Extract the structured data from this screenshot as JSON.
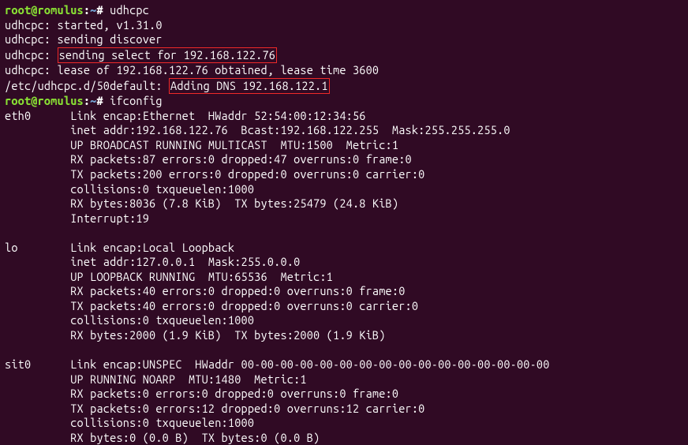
{
  "prompt": {
    "user_host": "root@romulus",
    "sep1": ":",
    "path": "~",
    "sep2": "# "
  },
  "cmd1": "udhcpc",
  "udhcpc": {
    "l1": "udhcpc: started, v1.31.0",
    "l2": "udhcpc: sending discover",
    "l3a": "udhcpc: ",
    "l3b": "sending select for 192.168.122.76",
    "l4": "udhcpc: lease of 192.168.122.76 obtained, lease time 3600",
    "l5a": "/etc/udhcpc.d/50default: ",
    "l5b": "Adding DNS 192.168.122.1"
  },
  "cmd2": "ifconfig",
  "eth0": {
    "l1": "eth0      Link encap:Ethernet  HWaddr 52:54:00:12:34:56  ",
    "l2": "          inet addr:192.168.122.76  Bcast:192.168.122.255  Mask:255.255.255.0",
    "l3": "          UP BROADCAST RUNNING MULTICAST  MTU:1500  Metric:1",
    "l4": "          RX packets:87 errors:0 dropped:47 overruns:0 frame:0",
    "l5": "          TX packets:200 errors:0 dropped:0 overruns:0 carrier:0",
    "l6": "          collisions:0 txqueuelen:1000 ",
    "l7": "          RX bytes:8036 (7.8 KiB)  TX bytes:25479 (24.8 KiB)",
    "l8": "          Interrupt:19 "
  },
  "blank": " ",
  "lo": {
    "l1": "lo        Link encap:Local Loopback  ",
    "l2": "          inet addr:127.0.0.1  Mask:255.0.0.0",
    "l3": "          UP LOOPBACK RUNNING  MTU:65536  Metric:1",
    "l4": "          RX packets:40 errors:0 dropped:0 overruns:0 frame:0",
    "l5": "          TX packets:40 errors:0 dropped:0 overruns:0 carrier:0",
    "l6": "          collisions:0 txqueuelen:1000 ",
    "l7": "          RX bytes:2000 (1.9 KiB)  TX bytes:2000 (1.9 KiB)"
  },
  "sit0": {
    "l1": "sit0      Link encap:UNSPEC  HWaddr 00-00-00-00-00-00-00-00-00-00-00-00-00-00-00-00  ",
    "l2": "          UP RUNNING NOARP  MTU:1480  Metric:1",
    "l3": "          RX packets:0 errors:0 dropped:0 overruns:0 frame:0",
    "l4": "          TX packets:0 errors:12 dropped:0 overruns:12 carrier:0",
    "l5": "          collisions:0 txqueuelen:1000 ",
    "l6": "          RX bytes:0 (0.0 B)  TX bytes:0 (0.0 B)"
  }
}
